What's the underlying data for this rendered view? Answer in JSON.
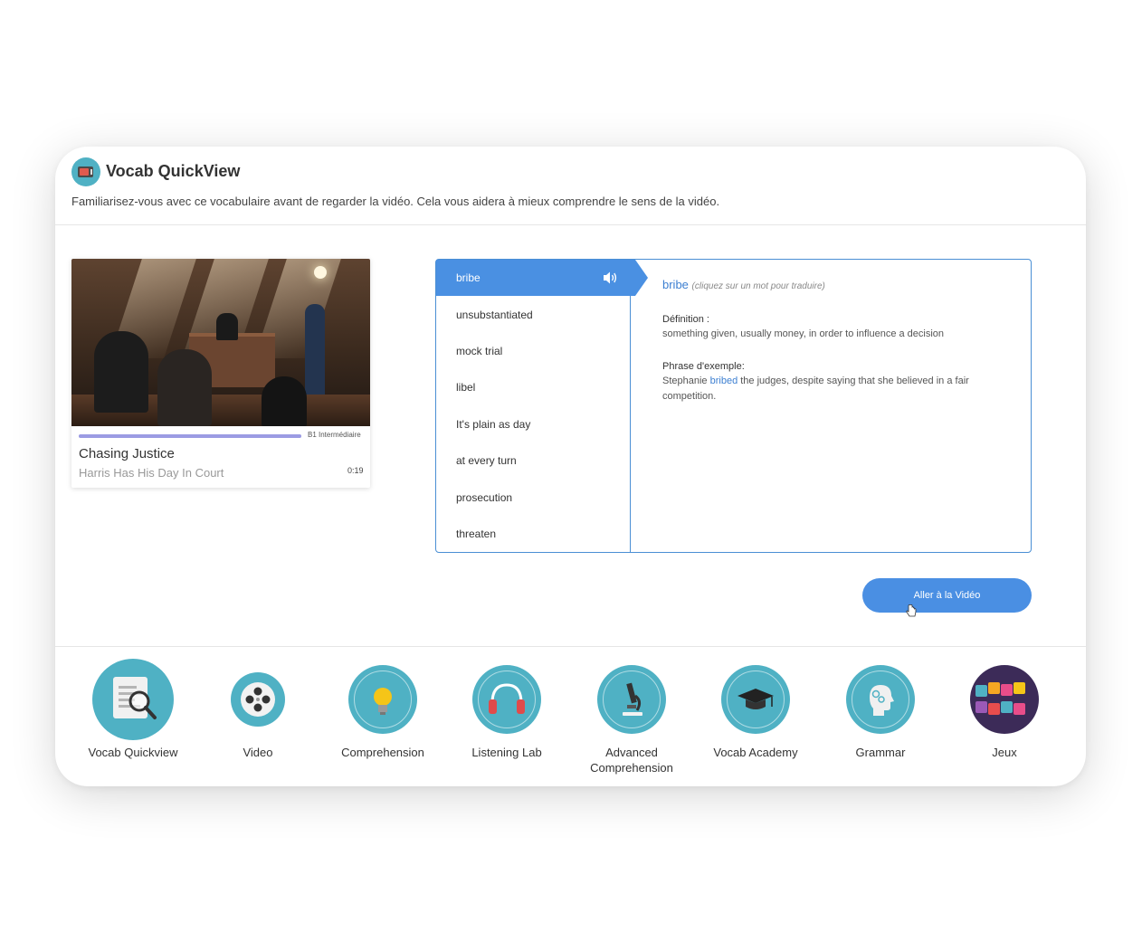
{
  "header": {
    "title": "Vocab QuickView",
    "subtitle": "Familiarisez-vous avec ce vocabulaire avant de regarder la vidéo. Cela vous aidera à mieux comprendre le sens de la vidéo."
  },
  "video": {
    "level": "B1 Intermédiaire",
    "title": "Chasing Justice",
    "subtitle": "Harris Has His Day In Court",
    "duration": "0:19",
    "progress": 1.0
  },
  "vocab": {
    "words": [
      "bribe",
      "unsubstantiated",
      "mock trial",
      "libel",
      "It's plain as day",
      "at every turn",
      "prosecution",
      "threaten"
    ],
    "selected_word": "bribe",
    "hint": "(cliquez sur un mot pour traduire)",
    "definition_label": "Définition :",
    "definition": "something given, usually money, in order to influence a decision",
    "example_label": "Phrase d'exemple:",
    "example_before": "Stephanie ",
    "example_highlight": "bribed",
    "example_after": " the judges, despite saying that she believed in a fair competition."
  },
  "actions": {
    "go_to_video": "Aller à la Vidéo"
  },
  "nav": {
    "items": [
      {
        "label": "Vocab Quickview",
        "icon": "document-search-icon"
      },
      {
        "label": "Video",
        "icon": "film-reel-icon"
      },
      {
        "label": "Comprehension",
        "icon": "lightbulb-icon"
      },
      {
        "label": "Listening Lab",
        "icon": "headphones-icon"
      },
      {
        "label": "Advanced Comprehension",
        "icon": "microscope-icon"
      },
      {
        "label": "Vocab Academy",
        "icon": "graduation-cap-icon"
      },
      {
        "label": "Grammar",
        "icon": "head-gears-icon"
      },
      {
        "label": "Jeux",
        "icon": "game-zone-icon"
      }
    ]
  },
  "colors": {
    "accent": "#4a90e2",
    "teal": "#4fb1c4",
    "progress": "#9b9be3"
  }
}
